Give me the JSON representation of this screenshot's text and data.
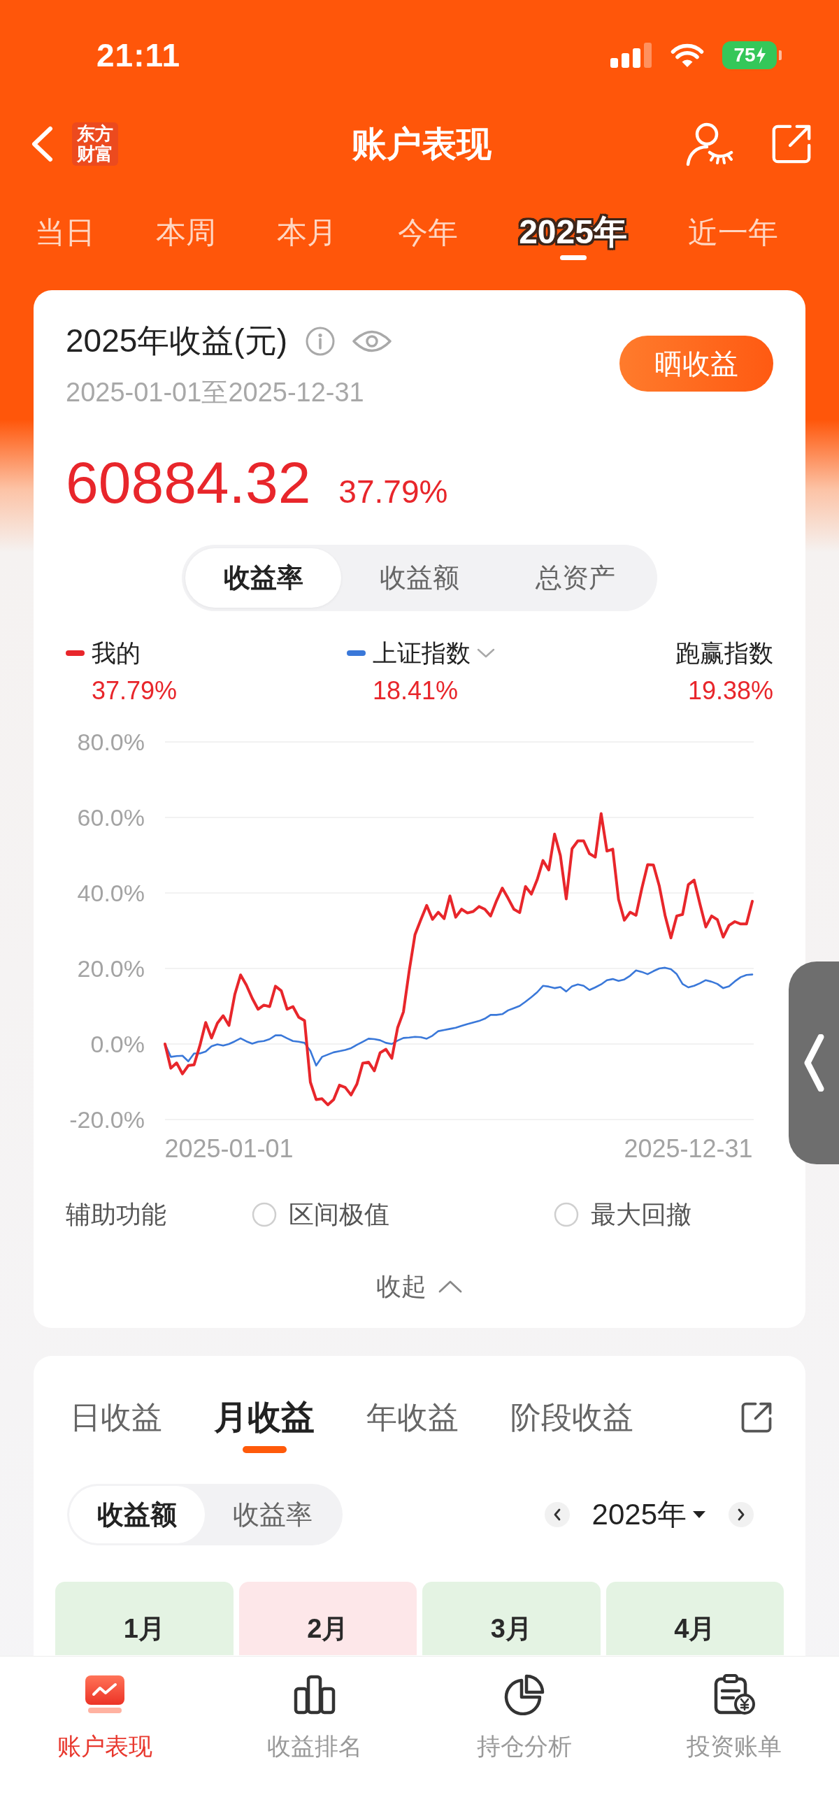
{
  "status_bar": {
    "time": "21:11",
    "battery": "75"
  },
  "nav_bar": {
    "logo": "东方财富",
    "title": "账户表现"
  },
  "period_tabs": [
    {
      "label": "当日",
      "selected": false
    },
    {
      "label": "本周",
      "selected": false
    },
    {
      "label": "本月",
      "selected": false
    },
    {
      "label": "今年",
      "selected": false
    },
    {
      "label": "2025年",
      "selected": true
    },
    {
      "label": "近一年",
      "selected": false
    }
  ],
  "summary_card": {
    "title": "2025年收益(元)",
    "date_range": "2025-01-01至2025-12-31",
    "share_button": "晒收益",
    "amount": "60884.32",
    "rate": "37.79%",
    "metric_tabs": [
      {
        "label": "收益率",
        "selected": true
      },
      {
        "label": "收益额",
        "selected": false
      },
      {
        "label": "总资产",
        "selected": false
      }
    ],
    "legend": [
      {
        "kind": "series",
        "value": "37.79%",
        "dropdown": false
      },
      {
        "kind": "series",
        "value": "18.41%",
        "dropdown": true
      },
      {
        "kind": "summary",
        "label": "跑赢指数",
        "value": "19.38%",
        "dropdown": false
      }
    ],
    "chart_data": {
      "type": "line",
      "grid": true,
      "categories": [
        null,
        null,
        null,
        null,
        null,
        null,
        null,
        null,
        null,
        null,
        null,
        "2025-01-01",
        null,
        null,
        null,
        null,
        null,
        null,
        null,
        null,
        null,
        null,
        null,
        null,
        null,
        null,
        null,
        null,
        null,
        null,
        null,
        null,
        null,
        null,
        null,
        null,
        null,
        null,
        null,
        null,
        null,
        null,
        null,
        null,
        null,
        null,
        null,
        null,
        null,
        null,
        null,
        null,
        null,
        null,
        null,
        null,
        null,
        null,
        null,
        null,
        null,
        null,
        null,
        null,
        null,
        null,
        null,
        null,
        null,
        null,
        null,
        null,
        null,
        null,
        null,
        null,
        null,
        null,
        null,
        null,
        null,
        null,
        null,
        null,
        null,
        null,
        null,
        null,
        null,
        null,
        "2025-12-31",
        null,
        null,
        null,
        null,
        null,
        null,
        null,
        null,
        null,
        null,
        null
      ],
      "series": [
        {
          "name": "我的",
          "color": "#e8262b",
          "values": [
            0,
            -6.4,
            -5,
            -7.9,
            -5.7,
            -5.5,
            -0.4,
            5.7,
            1.6,
            5.5,
            7.5,
            4.9,
            13.1,
            18.3,
            15.6,
            12.1,
            9.2,
            10.3,
            9.9,
            15.3,
            14.1,
            9.2,
            9.9,
            7.1,
            6.2,
            -10.1,
            -14.7,
            -14.5,
            -16.1,
            -14.7,
            -10.9,
            -11.5,
            -13.5,
            -10.6,
            -5.1,
            -4.8,
            -7.1,
            -2.3,
            -1.4,
            -3.8,
            4.3,
            8.5,
            19.4,
            29,
            32.9,
            36.7,
            33,
            34.9,
            33.2,
            39.2,
            33.6,
            35.7,
            34.7,
            35.1,
            36.4,
            35.7,
            33.9,
            37.9,
            41.3,
            38.6,
            35.7,
            34.8,
            41.7,
            39.7,
            43.5,
            48.6,
            46.1,
            55.6,
            49.9,
            38.4,
            51.7,
            53.8,
            53.8,
            50.4,
            49.5,
            61,
            51.1,
            51.6,
            38.3,
            32.8,
            34.9,
            34.1,
            41.2,
            47.5,
            47.4,
            41.9,
            34.1,
            28.1,
            33.9,
            34.3,
            42.2,
            43.4,
            37.1,
            31,
            33.9,
            32.9,
            28.3,
            31.4,
            32.4,
            31.8,
            31.8,
            37.8
          ]
        },
        {
          "name": "上证指数",
          "color": "#3a78d9",
          "values": [
            0,
            -3.4,
            -3.2,
            -3.1,
            -4.6,
            -2.5,
            -2.5,
            -2,
            -0.6,
            -0.1,
            -0.4,
            0,
            0.7,
            1.5,
            0.7,
            0.1,
            0.6,
            0.8,
            1.3,
            2.3,
            2.3,
            1.5,
            0.8,
            0.6,
            0.3,
            -1.8,
            -5.7,
            -3.4,
            -2.8,
            -2.2,
            -1.9,
            -1.6,
            -1.1,
            -0.2,
            0.6,
            1.4,
            1.3,
            1,
            0.3,
            0,
            0.9,
            1.6,
            1.7,
            1.9,
            1.8,
            1.4,
            2.2,
            3.4,
            3.7,
            4,
            4.3,
            4.8,
            5.3,
            5.7,
            6.1,
            6.7,
            7.7,
            7.7,
            7.9,
            8.9,
            9.5,
            10.1,
            11.2,
            12.4,
            13.7,
            15.4,
            15.2,
            14.8,
            15.1,
            13.9,
            15.3,
            15.8,
            15.4,
            14.3,
            15,
            15.8,
            16.9,
            17.2,
            16.7,
            17.1,
            18.1,
            19.5,
            19.1,
            18.5,
            19.3,
            20,
            20.2,
            19.8,
            18.5,
            15.9,
            15,
            15.4,
            16.1,
            16.9,
            16.5,
            15.9,
            14.8,
            15.3,
            16.6,
            17.7,
            18.3,
            18.4
          ]
        }
      ],
      "ylim": [
        -20,
        80
      ],
      "yticks": [
        {
          "value": 80,
          "label": "80.0%"
        },
        {
          "value": 60,
          "label": "60.0%"
        },
        {
          "value": 40,
          "label": "40.0%"
        },
        {
          "value": 20,
          "label": "20.0%"
        },
        {
          "value": 0,
          "label": "0.0%"
        },
        {
          "value": -20,
          "label": "-20.0%"
        }
      ]
    },
    "tools": {
      "label": "辅助功能",
      "options": [
        {
          "label": "区间极值",
          "checked": false
        },
        {
          "label": "最大回撤",
          "checked": false
        }
      ]
    },
    "collapse": "收起"
  },
  "returns_card": {
    "tabs": [
      {
        "label": "日收益",
        "selected": false
      },
      {
        "label": "月收益",
        "selected": true
      },
      {
        "label": "年收益",
        "selected": false
      },
      {
        "label": "阶段收益",
        "selected": false
      }
    ],
    "modes": [
      {
        "label": "收益额",
        "selected": true
      },
      {
        "label": "收益率",
        "selected": false
      }
    ],
    "year": "2025年",
    "months": [
      {
        "label": "1月",
        "color": "#e4f3e3"
      },
      {
        "label": "2月",
        "color": "#fde7e9"
      },
      {
        "label": "3月",
        "color": "#e4f3e3"
      },
      {
        "label": "4月",
        "color": "#e4f3e3"
      }
    ]
  },
  "tab_bar": [
    {
      "label": "账户表现",
      "selected": true
    },
    {
      "label": "收益排名",
      "selected": false
    },
    {
      "label": "持仓分析",
      "selected": false
    },
    {
      "label": "投资账单",
      "selected": false
    }
  ]
}
